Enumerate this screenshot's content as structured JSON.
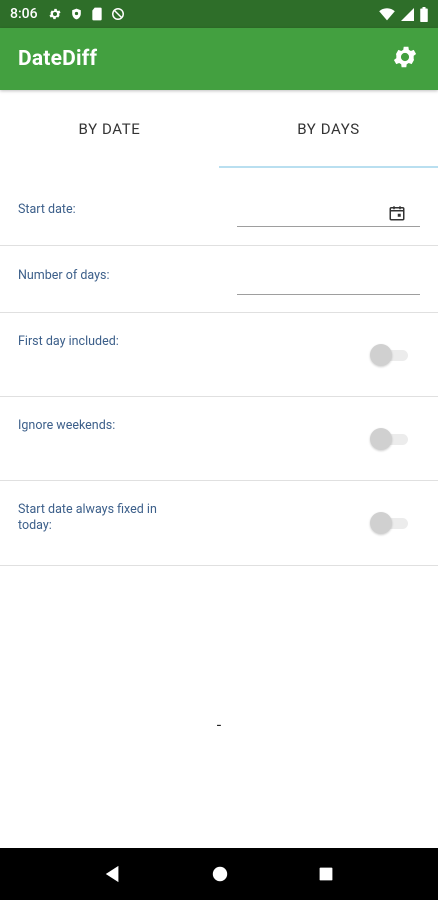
{
  "status_bar": {
    "time": "8:06",
    "left_icons": [
      "gear-icon",
      "shield-icon",
      "sd-card-icon",
      "no-sync-icon"
    ],
    "right_icons": [
      "wifi-icon",
      "signal-icon",
      "battery-icon"
    ]
  },
  "app_bar": {
    "title": "DateDiff",
    "settings_icon": "gear-icon"
  },
  "tabs": [
    {
      "label": "BY DATE",
      "active": false
    },
    {
      "label": "BY DAYS",
      "active": true
    }
  ],
  "form": {
    "start_date": {
      "label": "Start date:",
      "value": "",
      "icon": "calendar-icon"
    },
    "number_of_days": {
      "label": "Number of days:",
      "value": ""
    },
    "first_day_included": {
      "label": "First day included:",
      "checked": false
    },
    "ignore_weekends": {
      "label": "Ignore weekends:",
      "checked": false
    },
    "start_fixed_today": {
      "label": "Start date always fixed in today:",
      "checked": false
    }
  },
  "result": {
    "text": "-"
  },
  "nav_bar": {
    "buttons": [
      "back-icon",
      "home-icon",
      "recents-icon"
    ]
  },
  "colors": {
    "status_bar": "#2e6e29",
    "app_bar": "#43a040",
    "label_text": "#3c5f8a",
    "tab_indicator": "#b9dff0"
  }
}
